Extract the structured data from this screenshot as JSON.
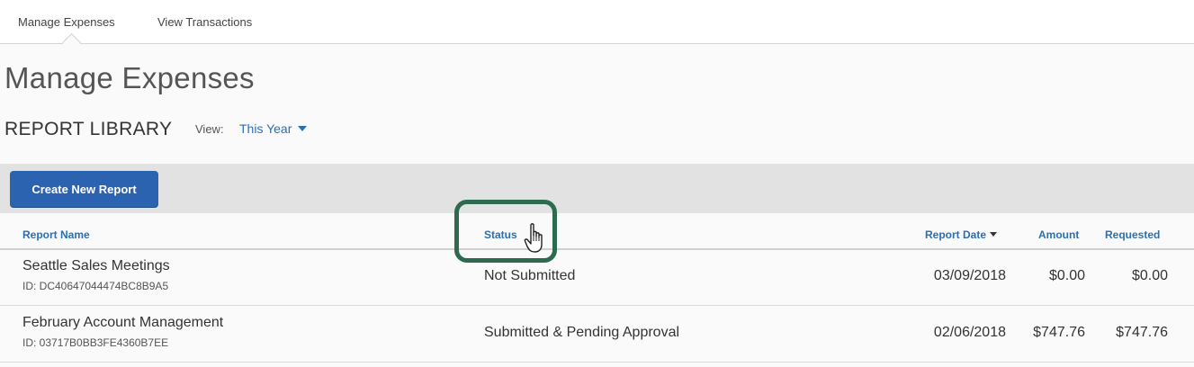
{
  "tabs": [
    {
      "label": "Manage Expenses",
      "active": true
    },
    {
      "label": "View Transactions",
      "active": false
    }
  ],
  "page_title": "Manage Expenses",
  "section_title": "REPORT LIBRARY",
  "view": {
    "label": "View:",
    "selected": "This Year"
  },
  "toolbar": {
    "create_label": "Create New Report"
  },
  "columns": {
    "report_name": "Report Name",
    "status": "Status",
    "report_date": "Report Date",
    "amount": "Amount",
    "requested": "Requested"
  },
  "rows": [
    {
      "name": "Seattle Sales Meetings",
      "id": "ID: DC40647044474BC8B9A5",
      "status": "Not Submitted",
      "date": "03/09/2018",
      "amount": "$0.00",
      "requested": "$0.00"
    },
    {
      "name": "February Account Management",
      "id": "ID: 03717B0BB3FE4360B7EE",
      "status": "Submitted & Pending Approval",
      "date": "02/06/2018",
      "amount": "$747.76",
      "requested": "$747.76"
    }
  ],
  "colors": {
    "accent": "#2a6fb3",
    "button": "#2c63b0",
    "highlight": "#2d6a4f"
  }
}
